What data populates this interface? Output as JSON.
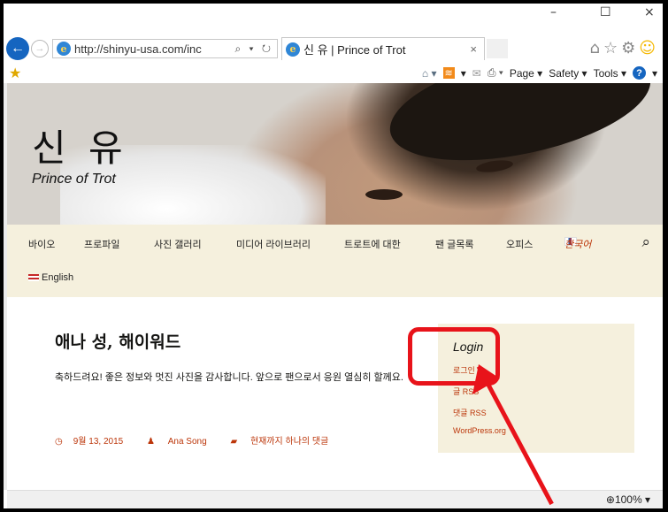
{
  "window": {
    "min_glyph": "–",
    "max_glyph": "☐",
    "close_glyph": "×"
  },
  "browser": {
    "address": "http://shinyu-usa.com/inc",
    "address_tools": "⌕ ▾ ↻",
    "tab_title": "신 유 | Prince of Trot",
    "tab_close": "×",
    "right_icons": "⌂☆⚙",
    "smiley": "☺",
    "commands": {
      "page": "Page ▾",
      "safety": "Safety ▾",
      "tools": "Tools ▾",
      "help": "?"
    }
  },
  "site": {
    "title": "신 유",
    "tagline": "Prince of Trot"
  },
  "nav": {
    "items": [
      "바이오",
      "프로파일",
      "사진 갤러리",
      "미디어 라이브러리",
      "트로트에 대한",
      "팬 글목록",
      "오피스"
    ],
    "korean": "한국어",
    "english": "English"
  },
  "post": {
    "title": "애나 성, 해이워드",
    "body": "축하드려요! 좋은 정보와 멋진 사진을 감사합니다. 앞으로 팬으로서 응원 열심히 할께요.",
    "date": "9월 13, 2015",
    "author": "Ana Song",
    "comments": "현재까지 하나의 댓글"
  },
  "sidebar": {
    "title": "Login",
    "links": [
      "로그인",
      "글 RSS",
      "댓글 RSS",
      "WordPress.org"
    ]
  },
  "status": {
    "zoom": "100%"
  },
  "colors": {
    "accent": "#bc360a",
    "nav_bg": "#f5f0dd",
    "highlight": "#e8131a"
  }
}
